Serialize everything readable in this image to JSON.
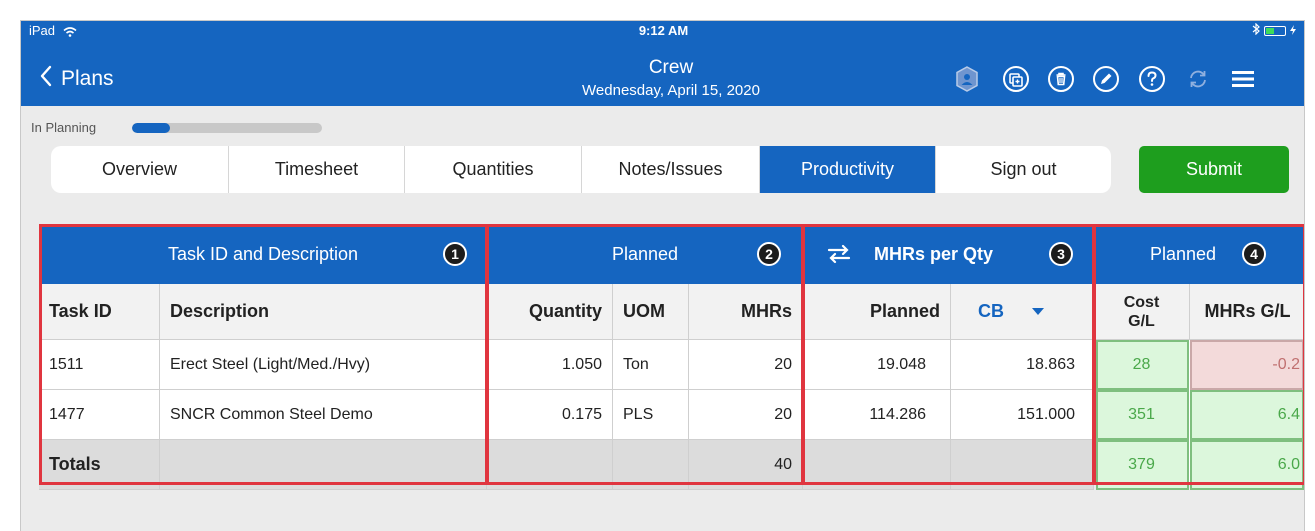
{
  "status_bar": {
    "device": "iPad",
    "time": "9:12 AM"
  },
  "nav": {
    "back_label": "Plans",
    "title": "Crew",
    "subtitle": "Wednesday, April 15, 2020",
    "icons": [
      "crew-icon",
      "copy-icon",
      "trash-icon",
      "edit-icon",
      "help-icon",
      "refresh-icon",
      "menu-icon"
    ]
  },
  "plan_status": {
    "label": "In Planning",
    "progress": 0.2
  },
  "tabs": [
    {
      "label": "Overview",
      "active": false
    },
    {
      "label": "Timesheet",
      "active": false
    },
    {
      "label": "Quantities",
      "active": false
    },
    {
      "label": "Notes/Issues",
      "active": false
    },
    {
      "label": "Productivity",
      "active": true
    },
    {
      "label": "Sign out",
      "active": false
    }
  ],
  "submit_label": "Submit",
  "groups": {
    "g1": {
      "label": "Task ID and Description",
      "badge": "1"
    },
    "g2": {
      "label": "Planned",
      "badge": "2"
    },
    "g3": {
      "label": "MHRs per Qty",
      "badge": "3"
    },
    "g4": {
      "label": "Planned",
      "badge": "4"
    }
  },
  "columns": {
    "task_id": "Task ID",
    "description": "Description",
    "quantity": "Quantity",
    "uom": "UOM",
    "mhrs": "MHRs",
    "planned": "Planned",
    "cb": "CB",
    "cost_gl": "Cost G/L",
    "mhrs_gl": "MHRs G/L"
  },
  "rows": [
    {
      "task_id": "1511",
      "description": "Erect Steel (Light/Med./Hvy)",
      "quantity": "1.050",
      "uom": "Ton",
      "mhrs": "20",
      "planned": "19.048",
      "cb": "18.863",
      "cost_gl": "28",
      "mhrs_gl": "-0.2"
    },
    {
      "task_id": "1477",
      "description": "SNCR Common Steel Demo",
      "quantity": "0.175",
      "uom": "PLS",
      "mhrs": "20",
      "planned": "114.286",
      "cb": "151.000",
      "cost_gl": "351",
      "mhrs_gl": "6.4"
    }
  ],
  "totals": {
    "label": "Totals",
    "mhrs": "40",
    "cost_gl": "379",
    "mhrs_gl": "6.0"
  },
  "colors": {
    "primary": "#1565c0",
    "submit": "#1e9e1e",
    "highlight": "#e0353f",
    "gain": "#dcf7dc",
    "loss": "#f3dada"
  }
}
